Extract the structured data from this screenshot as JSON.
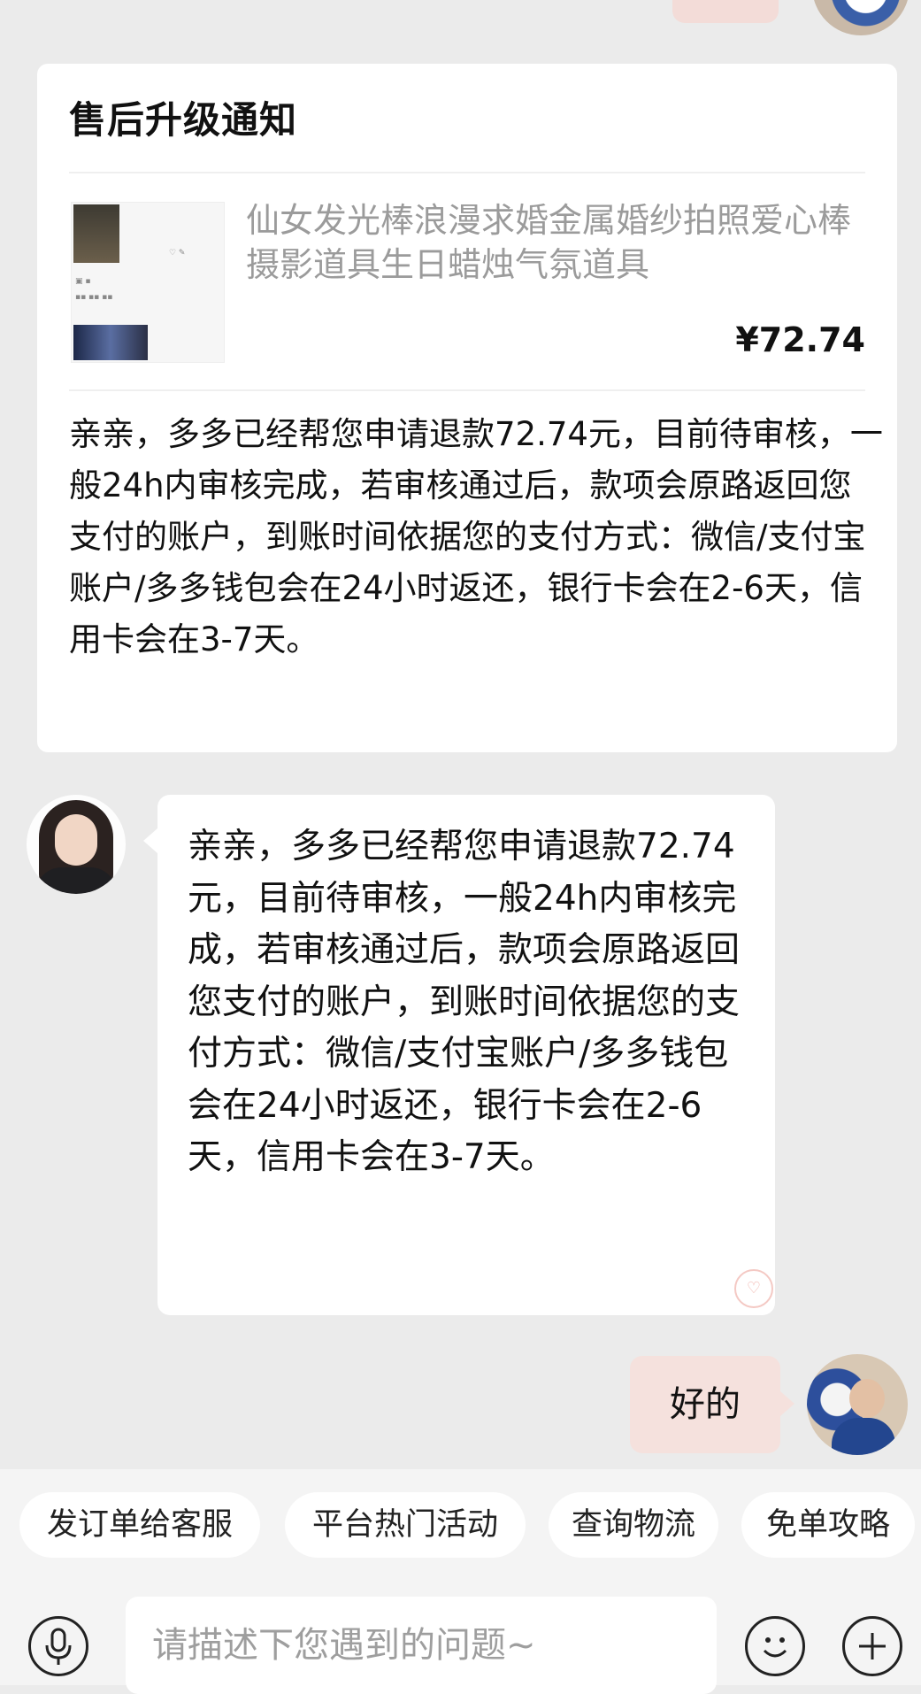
{
  "card": {
    "title": "售后升级通知",
    "product_name": "仙女发光棒浪漫求婚金属婚纱拍照爱心棒摄影道具生日蜡烛气氛道具",
    "price": "¥72.74",
    "message": "亲亲，多多已经帮您申请退款72.74元，目前待审核，一般24h内审核完成，若审核通过后，款项会原路返回您支付的账户，到账时间依据您的支付方式：微信/支付宝账户/多多钱包会在24小时返还，银行卡会在2-6天，信用卡会在3-7天。"
  },
  "agent_message": "亲亲，多多已经帮您申请退款72.74元，目前待审核，一般24h内审核完成，若审核通过后，款项会原路返回您支付的账户，到账时间依据您的支付方式：微信/支付宝账户/多多钱包会在24小时返还，银行卡会在2-6天，信用卡会在3-7天。",
  "user_message": "好的",
  "quick_actions": [
    {
      "label": "发订单给客服"
    },
    {
      "label": "平台热门活动"
    },
    {
      "label": "查询物流"
    },
    {
      "label": "免单攻略"
    }
  ],
  "input": {
    "placeholder": "请描述下您遇到的问题~"
  },
  "icons": {
    "voice": "microphone-icon",
    "emoji": "emoji-icon",
    "add": "plus-icon"
  }
}
